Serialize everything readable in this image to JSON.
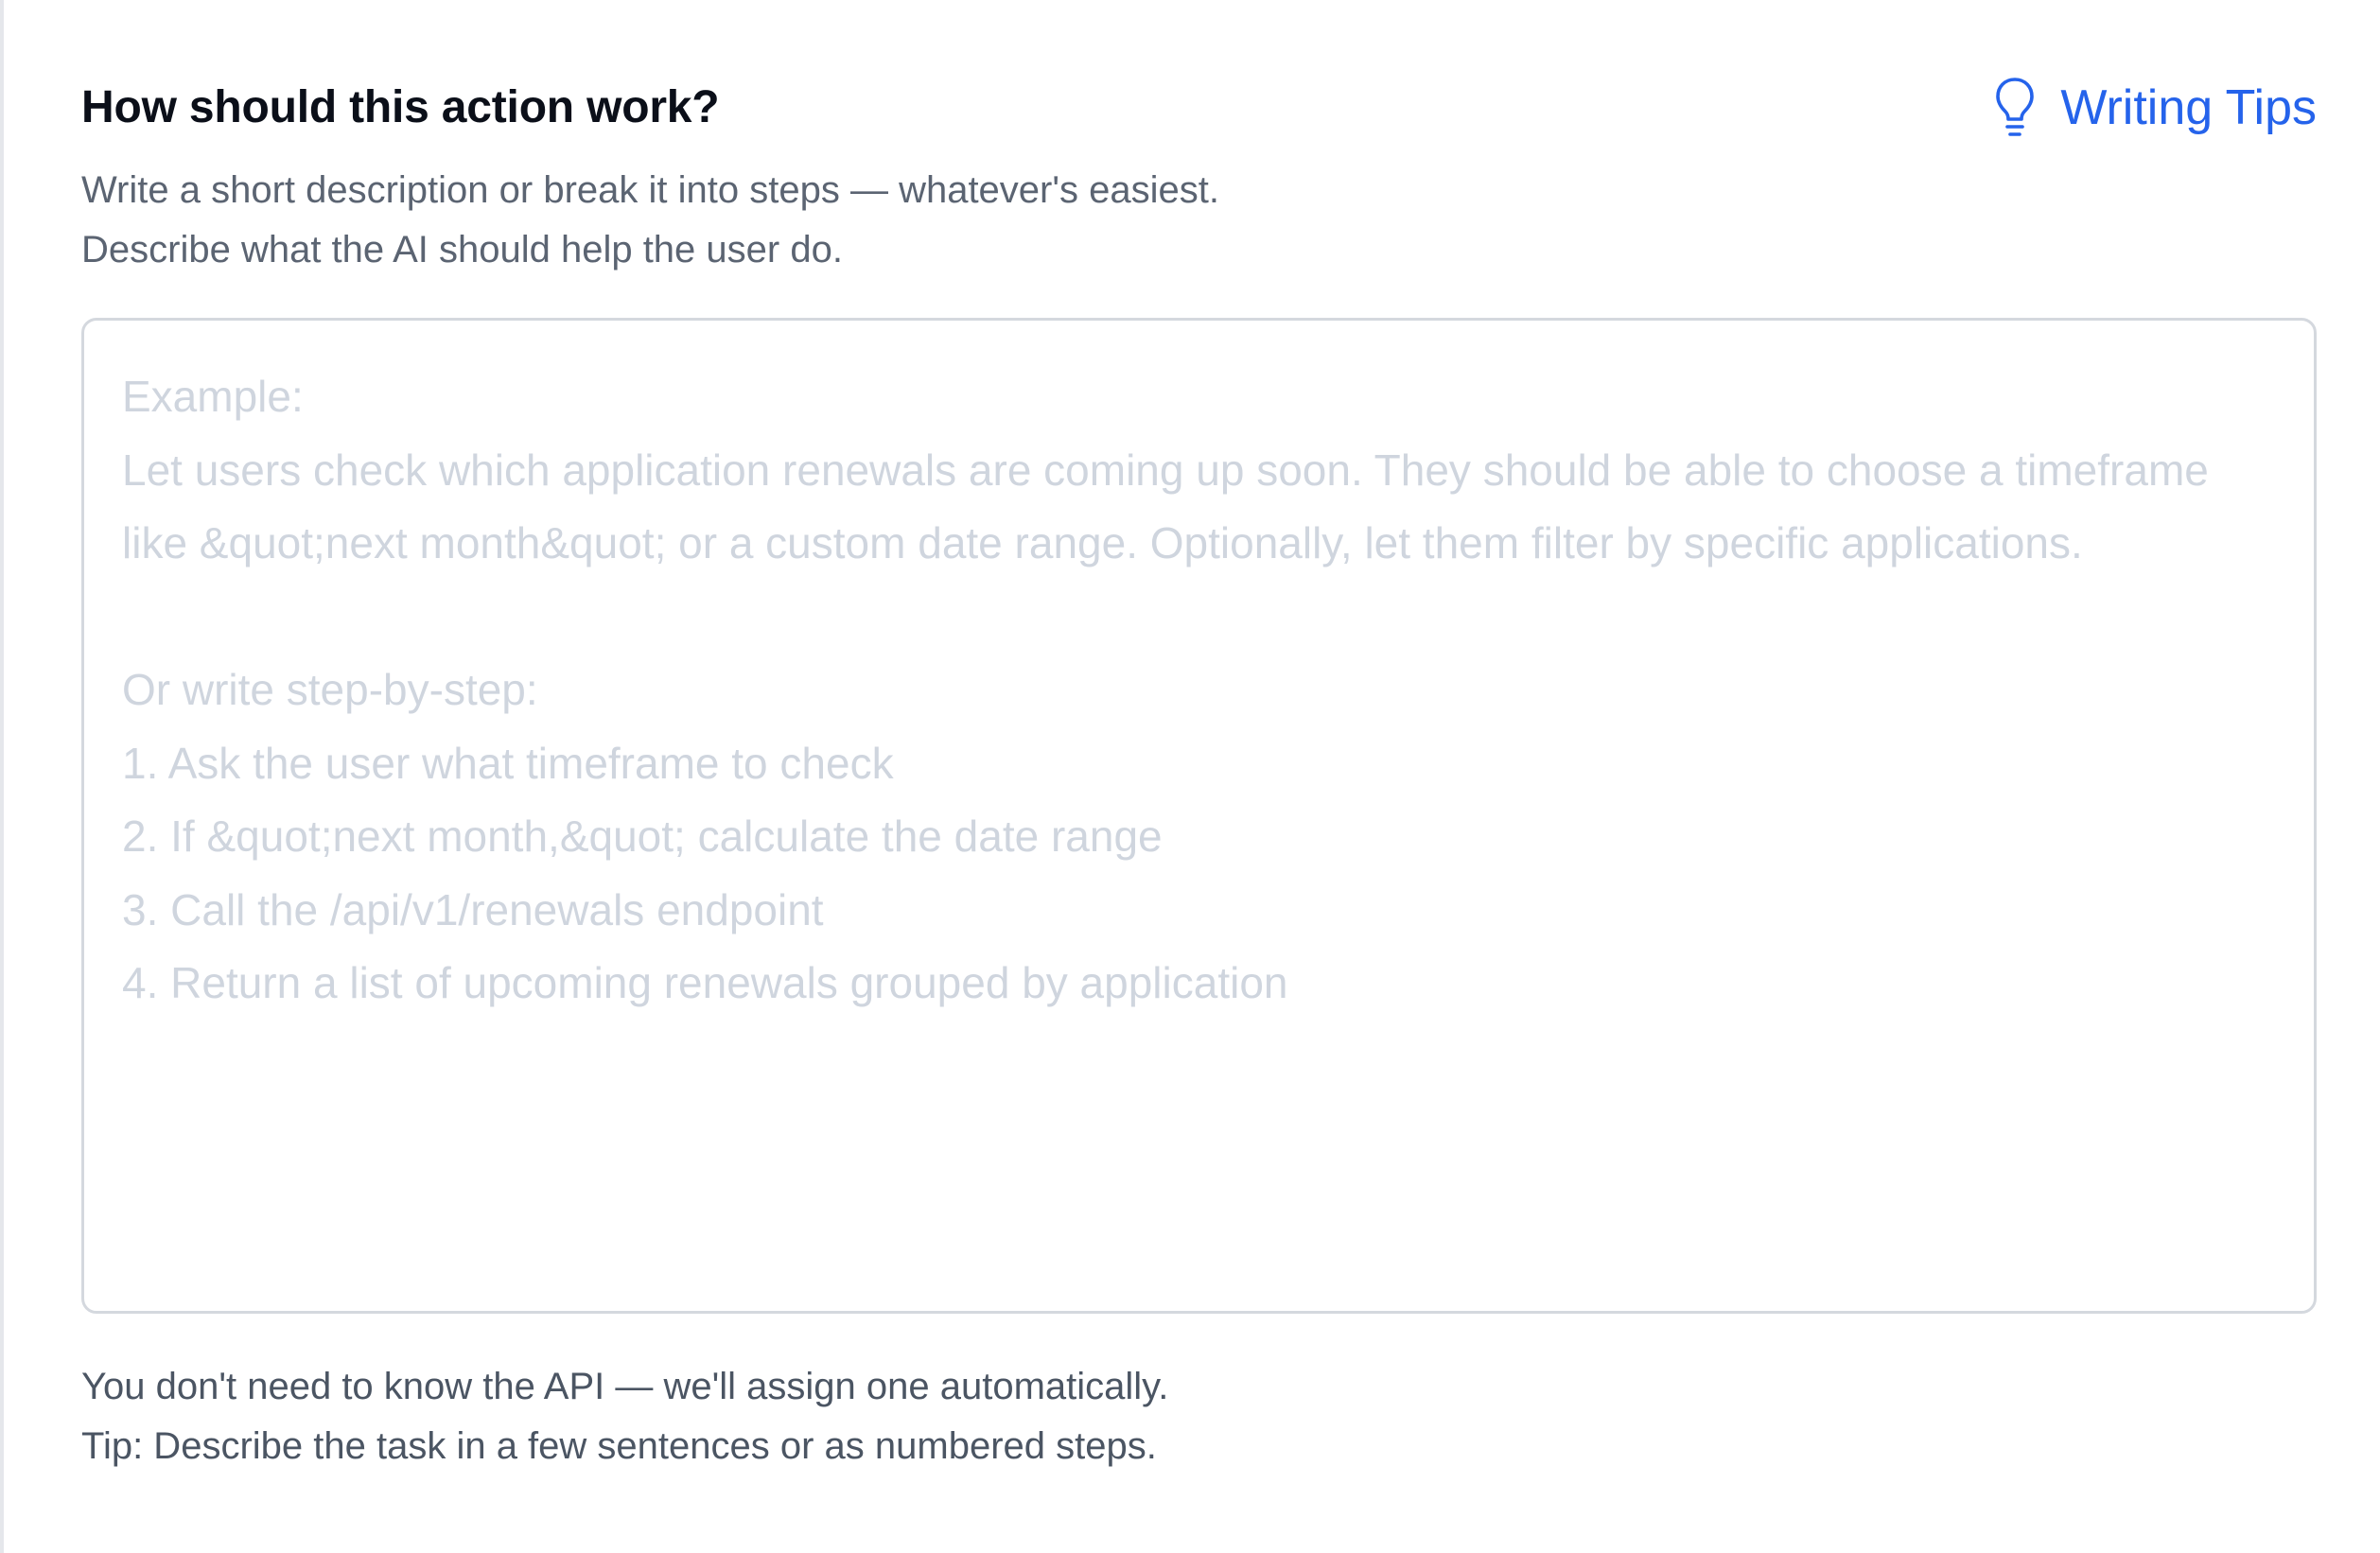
{
  "header": {
    "title": "How should this action work?",
    "tips_link": {
      "label": "Writing Tips",
      "icon": "lightbulb-icon"
    }
  },
  "description": {
    "line1": "Write a short description or break it into steps — whatever's easiest.",
    "line2": "Describe what the AI should help the user do."
  },
  "textarea": {
    "value": "",
    "placeholder": "Example:\nLet users check which application renewals are coming up soon. They should be able to choose a timeframe like &quot;next month&quot; or a custom date range. Optionally, let them filter by specific applications.\n\nOr write step-by-step:\n1. Ask the user what timeframe to check\n2. If &quot;next month,&quot; calculate the date range\n3. Call the /api/v1/renewals endpoint\n4. Return a list of upcoming renewals grouped by application"
  },
  "footer": {
    "line1": "You don't need to know the API — we'll assign one automatically.",
    "line2": "Tip: Describe the task in a few sentences or as numbered steps."
  },
  "colors": {
    "accent": "#2563eb",
    "title": "#0b0f19",
    "muted_text": "#5b6472",
    "placeholder": "#cfd5de",
    "border": "#d4d8de"
  }
}
